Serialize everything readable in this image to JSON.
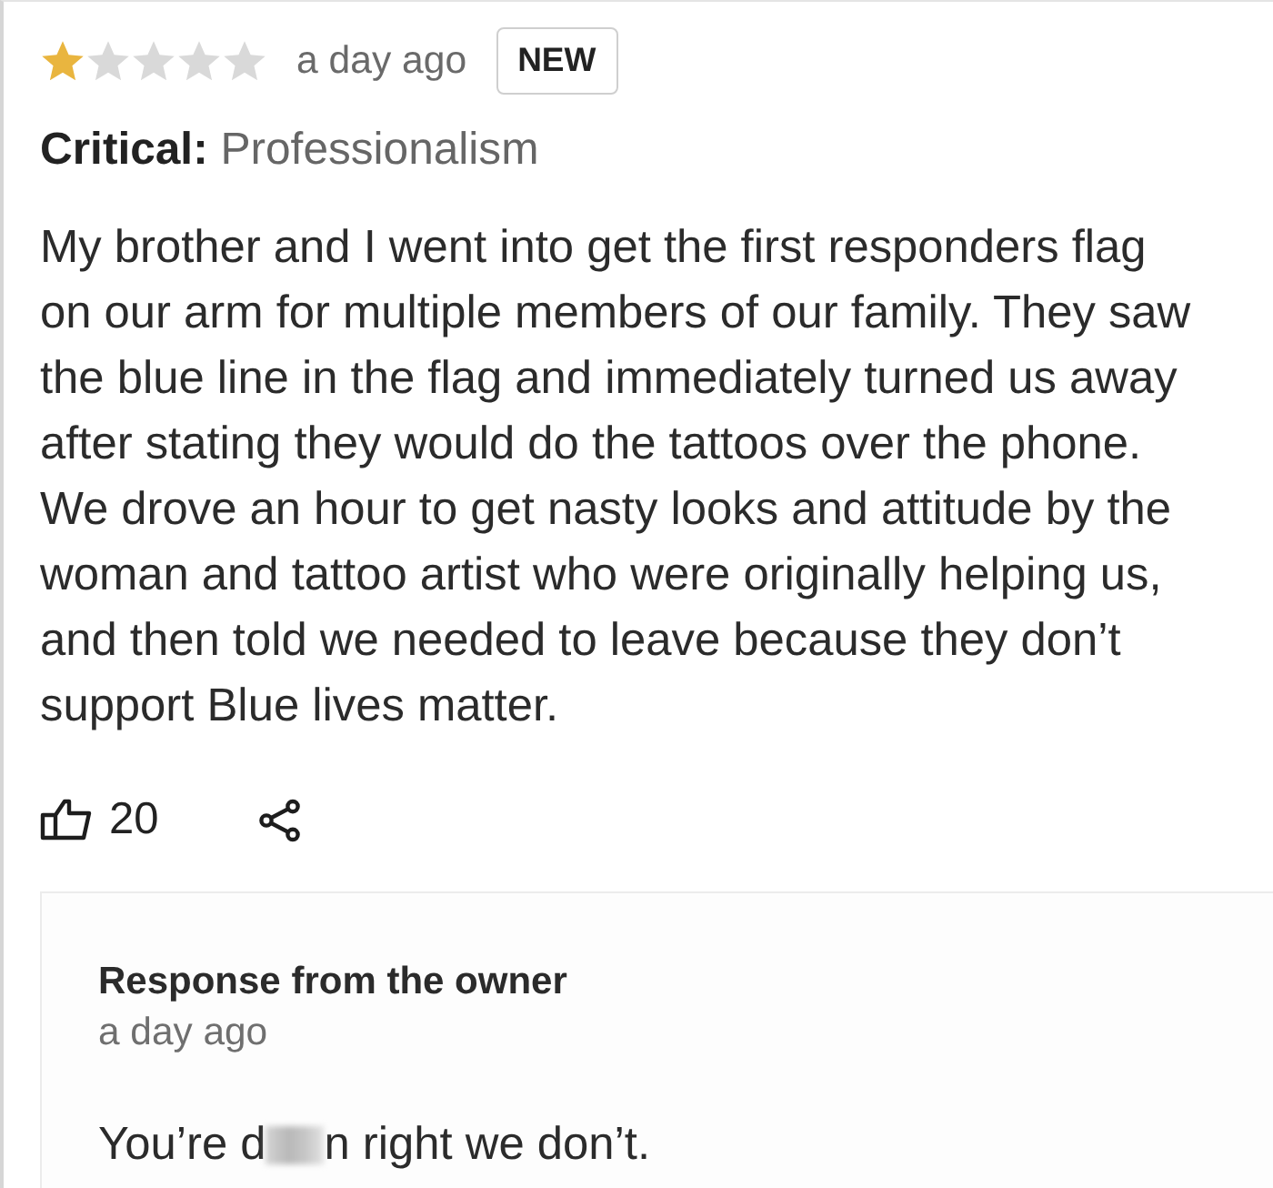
{
  "review": {
    "stars": 1,
    "time": "a day ago",
    "badge": "NEW",
    "category_label": "Critical:",
    "category": "Professionalism",
    "body": "My brother and I went into get the first responders flag on our arm for multiple members of our family. They saw the blue line in the flag and immediately turned us away after stating they would do the tattoos over the phone. We drove an hour to get nasty looks and attitude by the woman and tattoo artist who were originally helping us, and then told we needed to leave because they don’t support Blue lives matter.",
    "likes": "20"
  },
  "owner_response": {
    "title": "Response from the owner",
    "time": "a day ago",
    "text_before_blur": "You’re d",
    "blurred": true,
    "text_after_blur": "n right we don’t."
  }
}
